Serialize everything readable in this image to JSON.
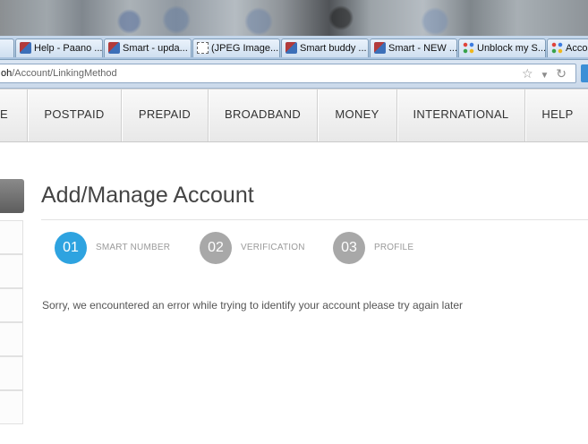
{
  "browser": {
    "tabs": [
      {
        "label": "Help - Paano ...",
        "icon": "gem-icon"
      },
      {
        "label": "Smart - upda...",
        "icon": "gem-icon"
      },
      {
        "label": "(JPEG Image...",
        "icon": "blank-page-icon"
      },
      {
        "label": "Smart buddy ...",
        "icon": "gem-icon"
      },
      {
        "label": "Smart - NEW ...",
        "icon": "gem-icon"
      },
      {
        "label": "Unblock my S...",
        "icon": "colored-dots-icon"
      },
      {
        "label": "Acco",
        "icon": "colored-dots-icon"
      }
    ],
    "url_prefix": "oh",
    "url_path": "/Account/LinkingMethod"
  },
  "nav": {
    "items": [
      "E",
      "POSTPAID",
      "PREPAID",
      "BROADBAND",
      "MONEY",
      "INTERNATIONAL",
      "HELP"
    ]
  },
  "page": {
    "title": "Add/Manage Account",
    "steps": [
      {
        "number": "01",
        "label": "SMART NUMBER",
        "color": "#2ea3e0"
      },
      {
        "number": "02",
        "label": "VERIFICATION",
        "color": "#a8a8a8"
      },
      {
        "number": "03",
        "label": "PROFILE",
        "color": "#a8a8a8"
      }
    ],
    "error_message": "Sorry, we encountered an error while trying to identify your account please try again later"
  }
}
